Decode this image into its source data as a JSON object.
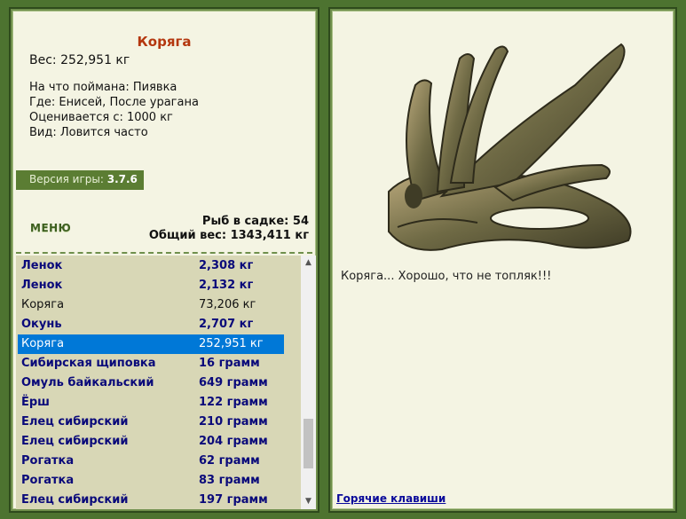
{
  "fish": {
    "title": "Коряга",
    "weight": "Вес: 252,951 кг",
    "bait": "На что поймана: Пиявка",
    "place": "Где: Енисей, После урагана",
    "price": "Оценивается с: 1000 кг",
    "kind": "Вид: Ловится часто"
  },
  "version": {
    "label": "Версия игры:",
    "value": "3.7.6"
  },
  "menu": {
    "label": "МЕНЮ"
  },
  "stats": {
    "count": "Рыб в садке: 54",
    "total": "Общий вес: 1343,411 кг"
  },
  "list": [
    {
      "name": "Ленок",
      "weight": "2,308 кг",
      "style": "bold"
    },
    {
      "name": "Ленок",
      "weight": "2,132 кг",
      "style": "bold"
    },
    {
      "name": "Коряга",
      "weight": "73,206 кг",
      "style": "normal"
    },
    {
      "name": "Окунь",
      "weight": "2,707 кг",
      "style": "bold"
    },
    {
      "name": "Коряга",
      "weight": "252,951 кг",
      "style": "selected"
    },
    {
      "name": "Сибирская щиповка",
      "weight": "16 грамм",
      "style": "bold"
    },
    {
      "name": "Омуль байкальский",
      "weight": "649 грамм",
      "style": "bold"
    },
    {
      "name": "Ёрш",
      "weight": "122 грамм",
      "style": "bold"
    },
    {
      "name": "Елец сибирский",
      "weight": "210 грамм",
      "style": "bold"
    },
    {
      "name": "Елец сибирский",
      "weight": "204 грамм",
      "style": "bold"
    },
    {
      "name": "Рогатка",
      "weight": "62 грамм",
      "style": "bold"
    },
    {
      "name": "Рогатка",
      "weight": "83 грамм",
      "style": "bold"
    },
    {
      "name": "Елец сибирский",
      "weight": "197 грамм",
      "style": "bold"
    }
  ],
  "caption": "Коряга... Хорошо, что не топляк!!!",
  "hotkeys": "Горячие клавиши",
  "colors": {
    "accent": "#b4370f",
    "selection": "#0078d7",
    "frame": "#4d7330"
  }
}
